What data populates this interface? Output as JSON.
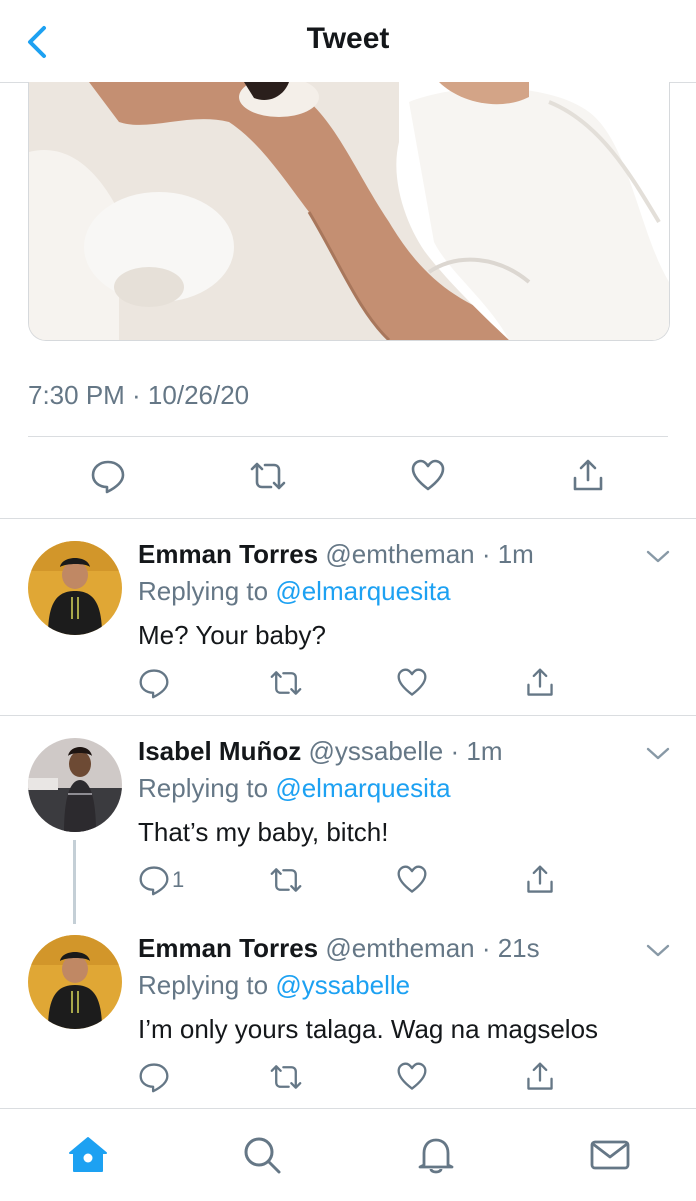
{
  "header": {
    "title": "Tweet",
    "back_icon": "chevron-left-icon"
  },
  "tweet": {
    "timestamp": "7:30 PM · 10/26/20"
  },
  "colors": {
    "accent": "#1da1f2",
    "secondary_text": "#657786",
    "primary_text": "#14171a",
    "divider": "#dadde0"
  },
  "replies": [
    {
      "name": "Emman Torres",
      "handle": "@emtheman · 1m",
      "replying_prefix": "Replying to ",
      "replying_to": "@elmarquesita",
      "text": "Me? Your baby?",
      "reply_count": ""
    },
    {
      "name": "Isabel Muñoz",
      "handle": "@yssabelle · 1m",
      "replying_prefix": "Replying to ",
      "replying_to": "@elmarquesita",
      "text": "That’s my baby, bitch!",
      "reply_count": "1"
    },
    {
      "name": "Emman Torres",
      "handle": "@emtheman · 21s",
      "replying_prefix": "Replying to ",
      "replying_to": "@yssabelle",
      "text": "I’m only yours talaga. Wag na magselos",
      "reply_count": ""
    }
  ],
  "tabbar": {
    "items": [
      "home-icon",
      "search-icon",
      "bell-icon",
      "mail-icon"
    ]
  }
}
